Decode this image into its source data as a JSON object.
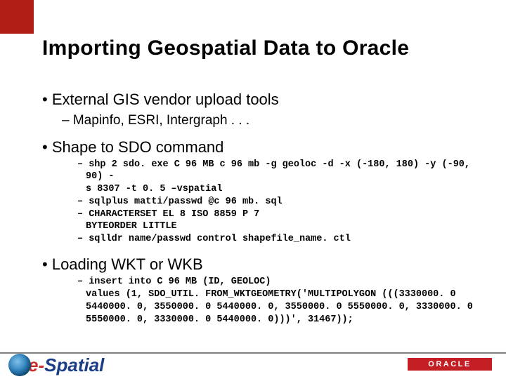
{
  "title": "Importing Geospatial Data to Oracle",
  "bullets": {
    "b1": "External GIS vendor upload tools",
    "b1_sub": "Mapinfo, ESRI, Intergraph . . .",
    "b2": "Shape to SDO command",
    "b2_code": {
      "c1a": "shp 2 sdo. exe C 96 MB c 96 mb -g geoloc -d -x (-180, 180) -y (-90, 90) -",
      "c1b": "s 8307 -t 0. 5 –vspatial",
      "c2": "sqlplus matti/passwd @c 96 mb. sql",
      "c3a": "CHARACTERSET EL 8 ISO 8859 P 7",
      "c3b": "BYTEORDER LITTLE",
      "c4": "sqlldr name/passwd control shapefile_name. ctl"
    },
    "b3": "Loading WKT or WKB",
    "b3_code": {
      "c1a": "insert into C 96 MB (ID, GEOLOC)",
      "c1b": "values (1, SDO_UTIL. FROM_WKTGEOMETRY('MULTIPOLYGON (((3330000. 0",
      "c1c": "5440000. 0, 3550000. 0 5440000. 0, 3550000. 0 5550000. 0, 3330000. 0",
      "c1d": "5550000. 0, 3330000. 0 5440000. 0)))', 31467));"
    }
  },
  "logos": {
    "espatial_e": "e",
    "espatial_dash": "-",
    "espatial_rest": "Spatial",
    "oracle": "ORACLE"
  }
}
